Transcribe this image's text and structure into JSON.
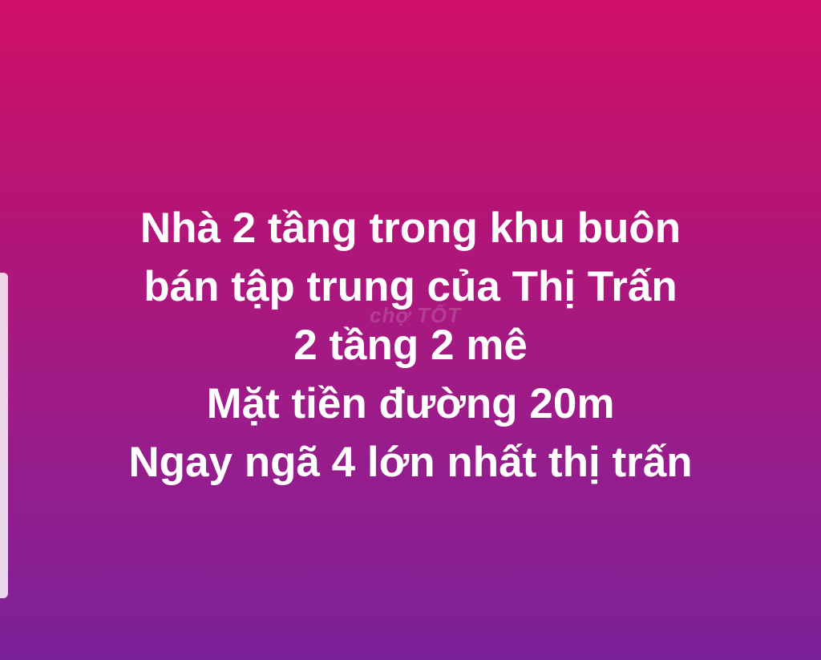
{
  "post": {
    "lines": [
      "Nhà 2 tầng trong khu buôn",
      "bán tập trung của Thị Trấn",
      "2 tầng 2 mê",
      "Mặt tiền đường 20m",
      "Ngay ngã 4 lớn nhất thị trấn"
    ]
  },
  "watermark": "chợ TỐT",
  "colors": {
    "gradient_top": "#cf0f67",
    "gradient_bottom": "#7b2199",
    "text": "#ffffff"
  }
}
